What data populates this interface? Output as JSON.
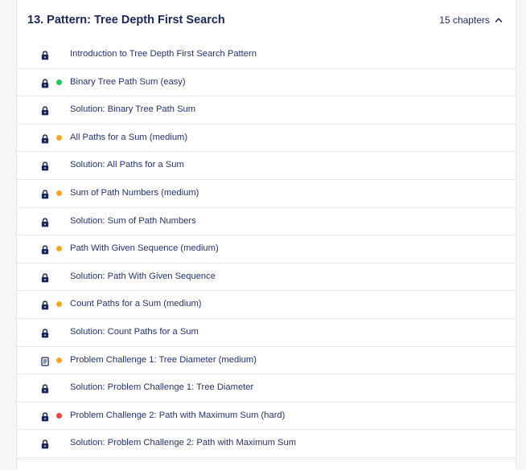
{
  "section": {
    "title": "13.  Pattern: Tree Depth First Search",
    "chapters_label": "15 chapters"
  },
  "colors": {
    "easy": "#22c55e",
    "medium": "#f5a623",
    "hard": "#ef4444"
  },
  "lessons": [
    {
      "label": "Introduction to Tree Depth First Search Pattern",
      "icon": "lock-icon",
      "difficulty": null
    },
    {
      "label": "Binary Tree Path Sum (easy)",
      "icon": "lock-icon",
      "difficulty": "easy"
    },
    {
      "label": "Solution: Binary Tree Path Sum",
      "icon": "lock-icon",
      "difficulty": null
    },
    {
      "label": "All Paths for a Sum (medium)",
      "icon": "lock-icon",
      "difficulty": "medium"
    },
    {
      "label": "Solution: All Paths for a Sum",
      "icon": "lock-icon",
      "difficulty": null
    },
    {
      "label": "Sum of Path Numbers (medium)",
      "icon": "lock-icon",
      "difficulty": "medium"
    },
    {
      "label": "Solution: Sum of Path Numbers",
      "icon": "lock-icon",
      "difficulty": null
    },
    {
      "label": "Path With Given Sequence (medium)",
      "icon": "lock-icon",
      "difficulty": "medium"
    },
    {
      "label": "Solution: Path With Given Sequence",
      "icon": "lock-icon",
      "difficulty": null
    },
    {
      "label": "Count Paths for a Sum (medium)",
      "icon": "lock-icon",
      "difficulty": "medium"
    },
    {
      "label": "Solution: Count Paths for a Sum",
      "icon": "lock-icon",
      "difficulty": null
    },
    {
      "label": "Problem Challenge 1: Tree Diameter (medium)",
      "icon": "document-icon",
      "difficulty": "medium"
    },
    {
      "label": "Solution: Problem Challenge 1: Tree Diameter",
      "icon": "lock-icon",
      "difficulty": null
    },
    {
      "label": "Problem Challenge 2: Path with Maximum Sum (hard)",
      "icon": "lock-icon",
      "difficulty": "hard"
    },
    {
      "label": "Solution: Problem Challenge 2: Path with Maximum Sum",
      "icon": "lock-icon",
      "difficulty": null
    }
  ]
}
